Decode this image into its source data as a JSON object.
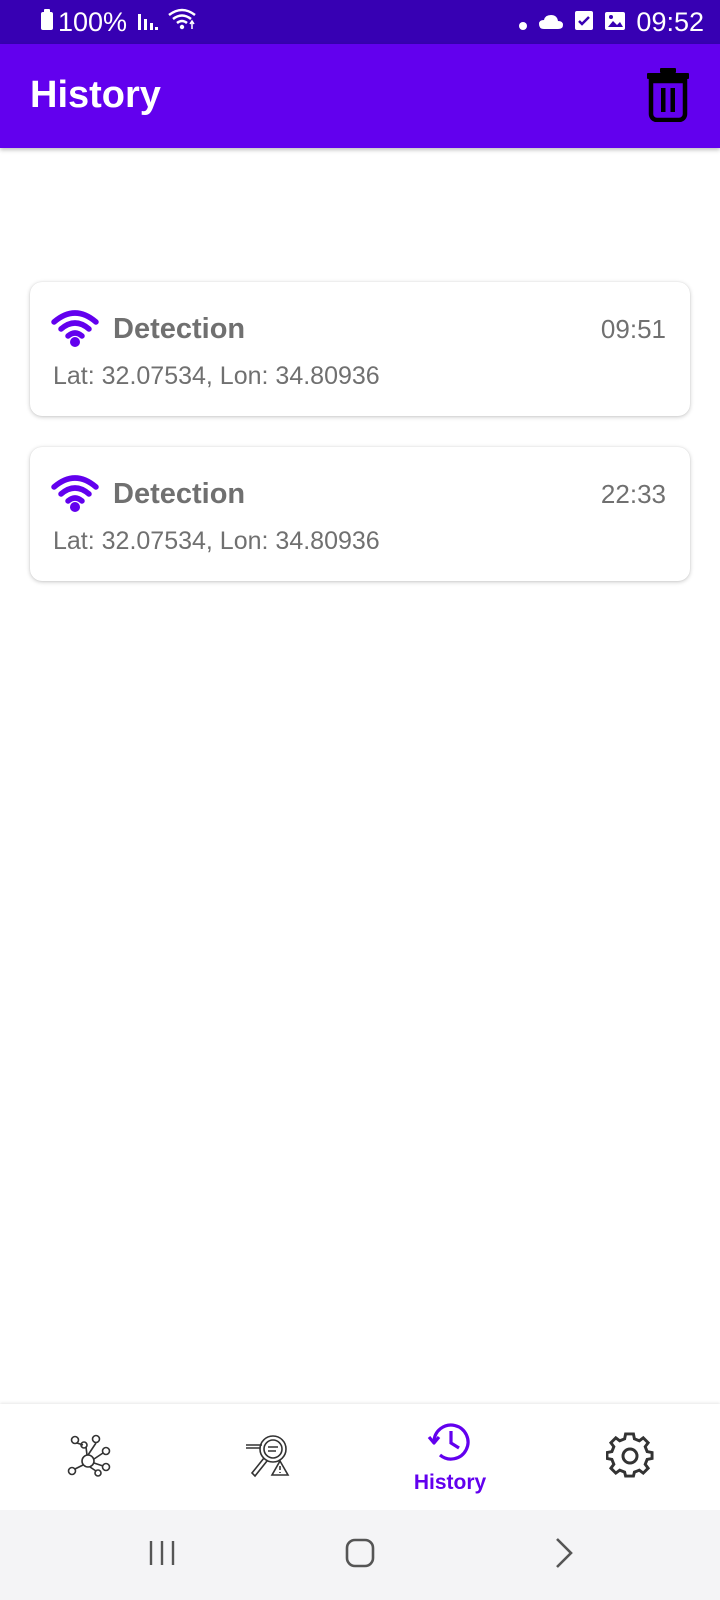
{
  "status_bar": {
    "battery": "100%",
    "time": "09:52",
    "icons": [
      "battery-icon",
      "signal-icon",
      "wifi-icon",
      "dot-icon",
      "cloud-icon",
      "checkbox-icon",
      "image-icon"
    ]
  },
  "app_bar": {
    "title": "History",
    "action_icon": "trash-icon"
  },
  "detections": [
    {
      "title": "Detection",
      "time": "09:51",
      "coords": "Lat: 32.07534, Lon: 34.80936",
      "icon": "wifi-icon"
    },
    {
      "title": "Detection",
      "time": "22:33",
      "coords": "Lat: 32.07534, Lon: 34.80936",
      "icon": "wifi-icon"
    }
  ],
  "bottom_nav": {
    "items": [
      {
        "icon": "network-icon",
        "label": ""
      },
      {
        "icon": "scan-alert-icon",
        "label": ""
      },
      {
        "icon": "history-icon",
        "label": "History",
        "selected": true
      },
      {
        "icon": "settings-icon",
        "label": ""
      }
    ]
  },
  "system_nav": [
    "recents-icon",
    "home-icon",
    "back-icon"
  ],
  "colors": {
    "status_bar": "#3700b3",
    "primary": "#6200ee",
    "text_secondary": "#707070"
  }
}
